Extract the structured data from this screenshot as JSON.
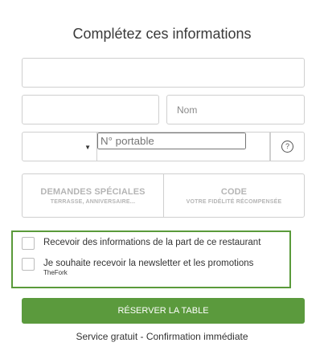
{
  "title": "Complétez ces informations",
  "fields": {
    "email_placeholder": "",
    "firstname_placeholder": "",
    "lastname_placeholder": "Nom",
    "phone_placeholder": "N° portable",
    "country_code_value": ""
  },
  "icons": {
    "help": "?",
    "caret": "▼"
  },
  "options": {
    "special": {
      "main": "DEMANDES SPÉCIALES",
      "sub": "TERRASSE, ANNIVERSAIRE..."
    },
    "code": {
      "main": "CODE",
      "sub": "VOTRE FIDÉLITÉ RÉCOMPENSÉE"
    }
  },
  "checkboxes": [
    {
      "label": "Recevoir des informations de la part de ce restaurant",
      "sub": ""
    },
    {
      "label": "Je souhaite recevoir la newsletter et les promotions",
      "sub": "TheFork"
    }
  ],
  "reserve_label": "RÉSERVER LA TABLE",
  "footer": "Service gratuit - Confirmation immédiate",
  "colors": {
    "accent": "#5b9a3d",
    "panel_border": "#5a9a3a"
  }
}
